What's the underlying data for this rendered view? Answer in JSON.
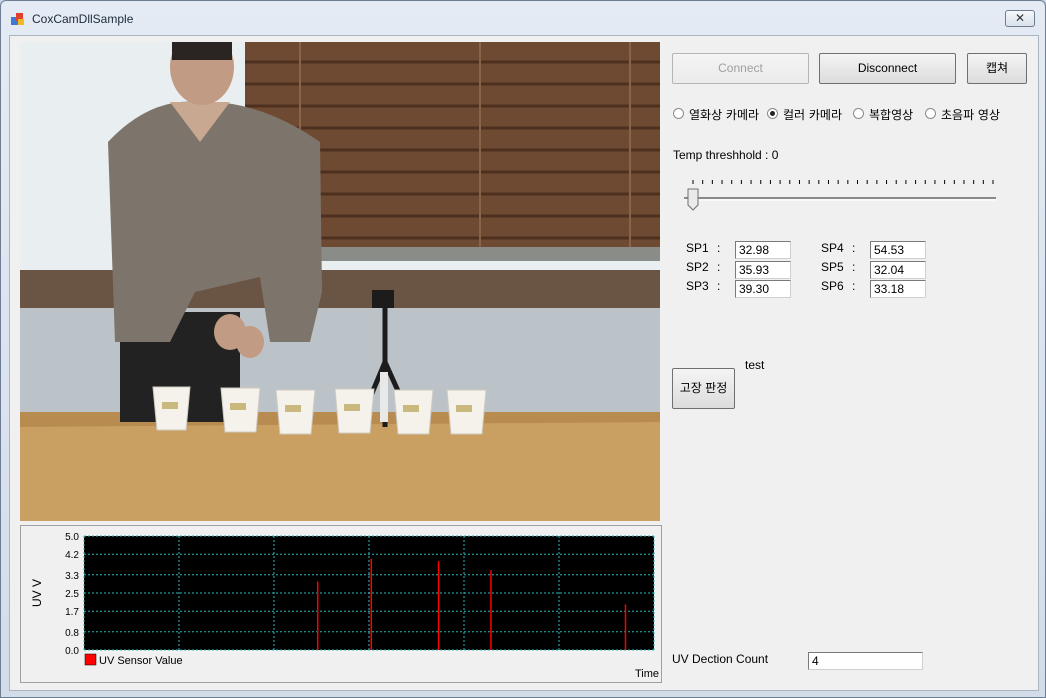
{
  "window": {
    "title": "CoxCamDllSample",
    "close_glyph": "✕"
  },
  "buttons": {
    "connect": "Connect",
    "disconnect": "Disconnect",
    "capture": "캡쳐",
    "fault_judge": "고장 판정"
  },
  "camera_modes": [
    {
      "label": "열화상 카메라",
      "checked": false
    },
    {
      "label": "컬러 카메라",
      "checked": true
    },
    {
      "label": "복합영상",
      "checked": false
    },
    {
      "label": "초음파 영상",
      "checked": false
    }
  ],
  "threshold": {
    "label": "Temp  threshhold  : 0",
    "value": 0
  },
  "spots": [
    {
      "label": "SP1",
      "value": "32.98"
    },
    {
      "label": "SP2",
      "value": "35.93"
    },
    {
      "label": "SP3",
      "value": "39.30"
    },
    {
      "label": "SP4",
      "value": "54.53"
    },
    {
      "label": "SP5",
      "value": "32.04"
    },
    {
      "label": "SP6",
      "value": "33.18"
    }
  ],
  "spot_separator": ":",
  "test_label": "test",
  "uv_count": {
    "label": "UV Dection Count",
    "value": "4"
  },
  "chart_data": {
    "type": "bar",
    "ylabel": "UV V",
    "xlabel": "Time",
    "ylim": [
      0,
      5.0
    ],
    "yticks": [
      "5.0",
      "4.2",
      "3.3",
      "2.5",
      "1.7",
      "0.8",
      "0.0"
    ],
    "legend": "UV Sensor Value",
    "series_color": "#ff0000",
    "background": "#000000",
    "grid_color": "#2fb7b7",
    "grid": true,
    "xlim": [
      0,
      100
    ],
    "spikes": [
      {
        "x": 41,
        "value": 3.0
      },
      {
        "x": 50.4,
        "value": 4.0
      },
      {
        "x": 62.2,
        "value": 3.9
      },
      {
        "x": 71.4,
        "value": 3.5
      },
      {
        "x": 95,
        "value": 2.0
      }
    ]
  }
}
